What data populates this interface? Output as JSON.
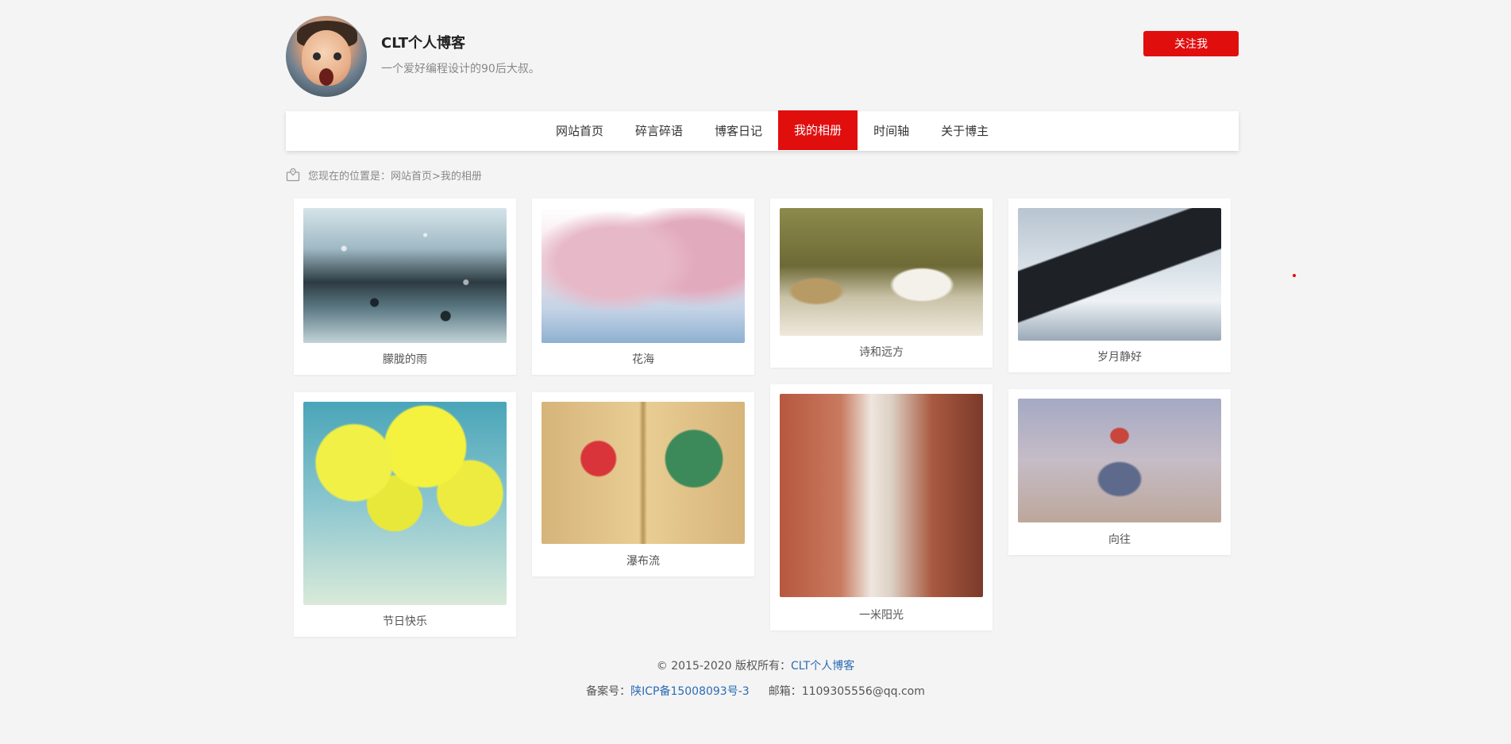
{
  "header": {
    "title": "CLT个人博客",
    "subtitle": "一个爱好编程设计的90后大叔。",
    "follow_label": "关注我"
  },
  "nav": {
    "items": [
      {
        "label": "网站首页",
        "active": false
      },
      {
        "label": "碎言碎语",
        "active": false
      },
      {
        "label": "博客日记",
        "active": false
      },
      {
        "label": "我的相册",
        "active": true
      },
      {
        "label": "时间轴",
        "active": false
      },
      {
        "label": "关于博主",
        "active": false
      }
    ]
  },
  "breadcrumb": {
    "text": "您现在的位置是：网站首页>我的相册"
  },
  "gallery": {
    "items": [
      {
        "caption": "朦胧的雨"
      },
      {
        "caption": "花海"
      },
      {
        "caption": "诗和远方"
      },
      {
        "caption": "岁月静好"
      },
      {
        "caption": "节日快乐"
      },
      {
        "caption": "瀑布流"
      },
      {
        "caption": "一米阳光"
      },
      {
        "caption": "向往"
      }
    ]
  },
  "footer": {
    "copyright_prefix": "© 2015-2020 版权所有：",
    "copyright_owner": "CLT个人博客",
    "record_label": "备案号：",
    "record_number": "陕ICP备15008093号-3",
    "email_label": "邮箱：",
    "email": "1109305556@qq.com"
  },
  "colors": {
    "accent": "#e10e0e",
    "link": "#2c6bb5",
    "background": "#f4f4f4"
  }
}
